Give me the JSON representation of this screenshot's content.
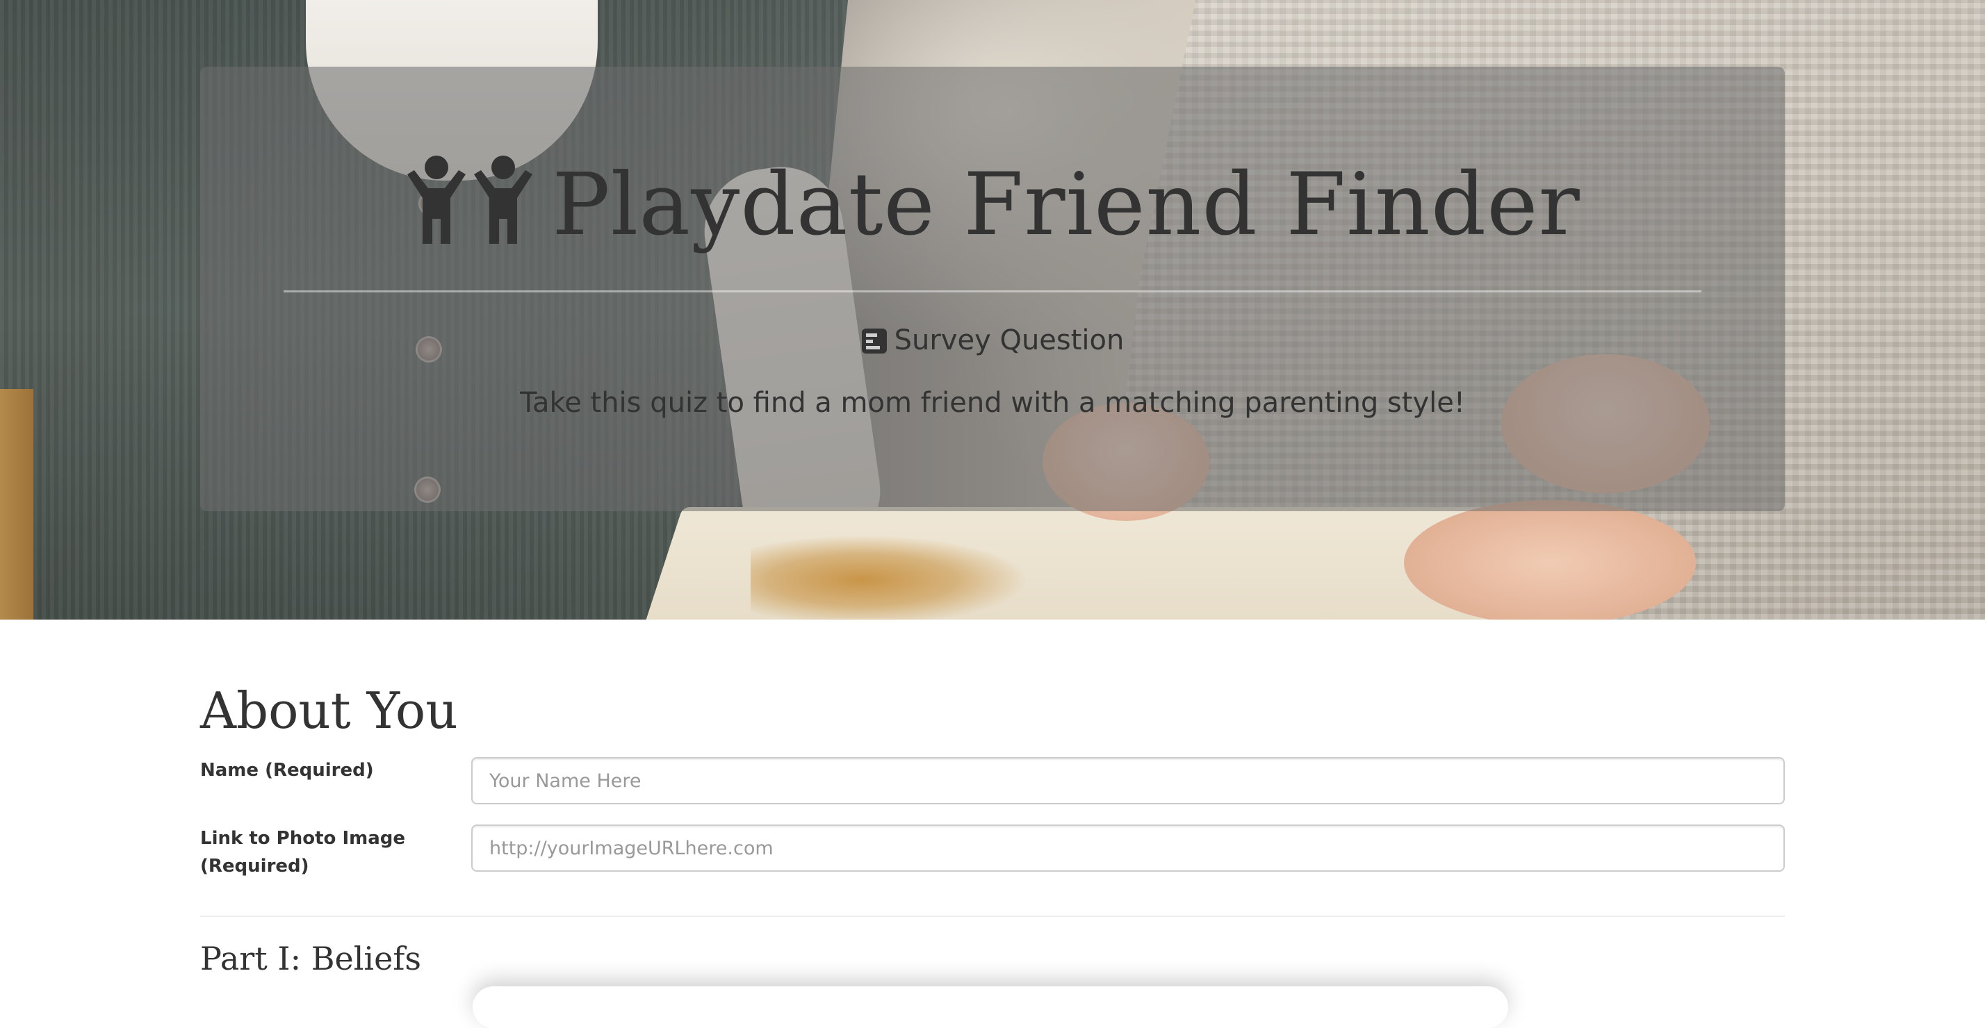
{
  "hero": {
    "title": "Playdate Friend Finder",
    "title_icon": "child-icon",
    "subhead": "Survey Question",
    "subhead_icon": "survey-icon",
    "lead": "Take this quiz to find a mom friend with a matching parenting style!"
  },
  "about": {
    "heading": "About You",
    "name_label": "Name (Required)",
    "name_placeholder": "Your Name Here",
    "photo_label": "Link to Photo Image (Required)",
    "photo_placeholder": "http://yourImageURLhere.com"
  },
  "part1": {
    "heading": "Part I: Beliefs"
  },
  "colors": {
    "text": "#333333",
    "panel_overlay": "rgba(110,110,110,0.55)",
    "input_border": "#cccccc",
    "placeholder": "#999999",
    "divider": "#eeeeee"
  }
}
